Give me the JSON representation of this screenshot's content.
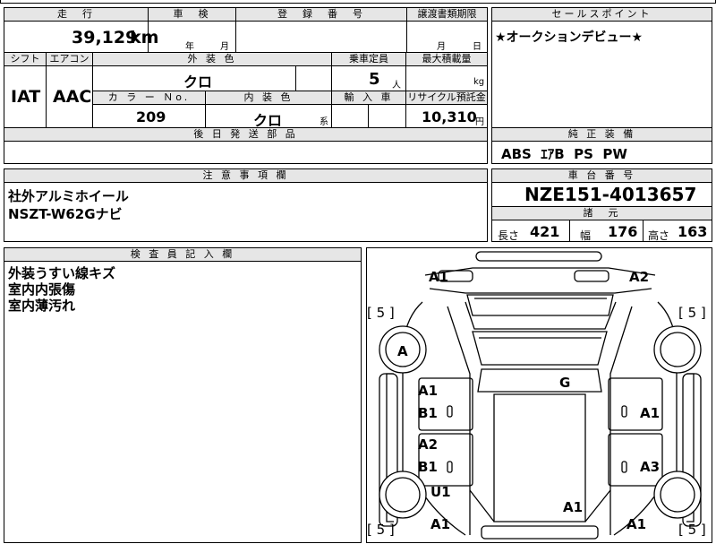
{
  "top": {
    "mileage_hdr": "走　行",
    "shaken_hdr": "車　検",
    "reg_hdr": "登　録　番　号",
    "transfer_hdr": "譲渡書類期限",
    "sales_hdr": "セールスポイント",
    "mileage_value": "39,129",
    "mileage_unit": "km",
    "shaken_year": "年",
    "shaken_month": "月",
    "transfer_month": "月",
    "transfer_day": "日",
    "sales_text": "★オークションデビュー★"
  },
  "row2": {
    "shift_hdr": "シフト",
    "ac_hdr": "エアコン",
    "ext_color_hdr": "外 装 色",
    "capacity_hdr": "乗車定員",
    "load_hdr": "最大積載量",
    "shift_value": "IAT",
    "ac_value": "AAC",
    "ext_color_value": "クロ",
    "capacity_value": "5",
    "capacity_unit": "人",
    "load_unit": "kg",
    "color_no_hdr": "カ ラ ー Ｎo.",
    "int_color_hdr": "内 装 色",
    "import_hdr": "輸 入 車",
    "recycle_hdr": "リサイクル預託金",
    "color_no_value": "209",
    "int_color_value": "クロ",
    "int_color_suffix": "系",
    "recycle_value": "10,310",
    "recycle_unit": "円",
    "later_parts_hdr": "後 日 発 送 部 品",
    "genuine_hdr": "純 正 装 備",
    "genuine_value": "ABS  ｴｱB  PS  PW"
  },
  "notes": {
    "hdr": "注 意 事 項 欄",
    "line1": "社外アルミホイール",
    "line2": "NSZT-W62Gナビ"
  },
  "vehicle": {
    "chassis_hdr": "車 台 番 号",
    "chassis_value": "NZE151-4013657",
    "spec_hdr": "諸　元",
    "length_label": "長さ",
    "length_value": "421",
    "width_label": "幅",
    "width_value": "176",
    "height_label": "高さ",
    "height_value": "163"
  },
  "inspector": {
    "hdr": "検 査 員 記 入 欄",
    "line1": "外装うすい線キズ",
    "line2": "室内内張傷",
    "line3": "室内薄汚れ"
  },
  "diagram": {
    "marks": [
      "A1",
      "A2",
      "[ 5 ]",
      "[ 5 ]",
      "A",
      "G",
      "A1",
      "B1",
      "A1",
      "A2",
      "B1",
      "A3",
      "U1",
      "A1",
      "A1",
      "A1",
      "[ 5 ]",
      "[ 5 ]"
    ]
  }
}
